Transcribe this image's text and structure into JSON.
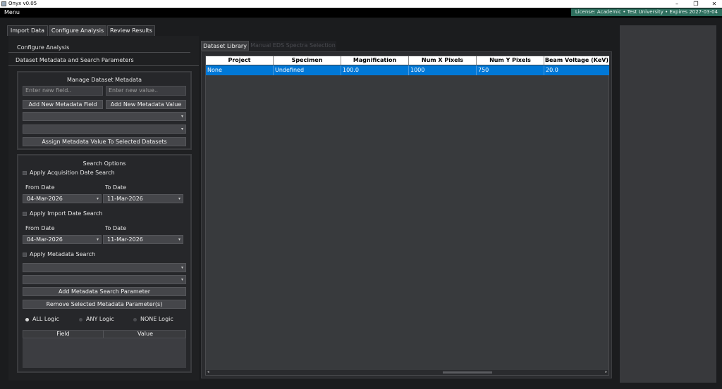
{
  "window": {
    "title": "Onyx v0.05",
    "minimize": "–",
    "restore": "❐",
    "close": "✕"
  },
  "menubar": {
    "menu_label": "Menu",
    "license_text": "License: Academic • Test University • Expires 2027-03-04",
    "license_color": "#2e6f5e"
  },
  "main_tabs": [
    "Import Data",
    "Configure Analysis",
    "Review Results"
  ],
  "left": {
    "sub_tabs": [
      "Configure Analysis",
      "Dataset Metadata and Search Parameters"
    ],
    "metadata": {
      "title": "Manage Dataset Metadata",
      "field_placeholder": "Enter new field..",
      "value_placeholder": "Enter new value..",
      "add_field_btn": "Add New Metadata Field",
      "add_value_btn": "Add New Metadata Value",
      "assign_btn": "Assign Metadata Value To Selected Datasets"
    },
    "search": {
      "title": "Search Options",
      "acq_check": "Apply Acquisition Date Search",
      "from_label": "From Date",
      "to_label": "To Date",
      "acq_from": "04-Mar-2026",
      "acq_to": "11-Mar-2026",
      "import_check": "Apply Import Date Search",
      "import_from": "04-Mar-2026",
      "import_to": "11-Mar-2026",
      "meta_check": "Apply Metadata Search",
      "add_param_btn": "Add Metadata Search Parameter",
      "remove_param_btn": "Remove Selected Metadata Parameter(s)",
      "logic": [
        "ALL Logic",
        "ANY Logic",
        "NONE Logic"
      ],
      "kv_headers": [
        "Field",
        "Value"
      ]
    }
  },
  "right_tabs": [
    "Dataset Library",
    "Manual EDS Spectra Selection"
  ],
  "table": {
    "columns": [
      "Project",
      "Specimen",
      "Magnification",
      "Num X Pixels",
      "Num Y Pixels",
      "Beam Voltage (KeV)"
    ],
    "rows": [
      [
        "None",
        "Undefined",
        "100.0",
        "1000",
        "750",
        "20.0"
      ]
    ],
    "selected_color": "#0078d7"
  },
  "scroll": {
    "left_arrow": "◂",
    "right_arrow": "▸"
  },
  "combo_arrow": "▾"
}
